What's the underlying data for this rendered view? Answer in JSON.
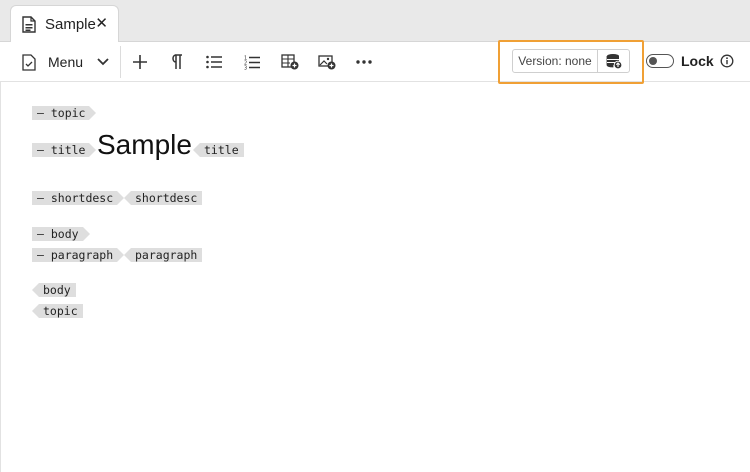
{
  "tab": {
    "title": "Sample",
    "close_glyph": "✕",
    "icon": "document-icon"
  },
  "toolbar": {
    "menu_label": "Menu",
    "icons": [
      "edit-doc-icon",
      "chevron-down-icon",
      "plus-icon",
      "pilcrow-icon",
      "bullet-list-icon",
      "numbered-list-icon",
      "insert-table-icon",
      "insert-image-icon",
      "more-icon"
    ],
    "version_label": "Version: none",
    "lock_label": "Lock",
    "lock_on": false,
    "highlight_color": "#f0a035"
  },
  "editor": {
    "tags": {
      "topic_open": "— topic",
      "title_open": "— title",
      "title_text": "Sample",
      "title_close": "title",
      "shortdesc_open": "— shortdesc",
      "shortdesc_close": "shortdesc",
      "body_open": "— body",
      "paragraph_open": "— paragraph",
      "paragraph_close": "paragraph",
      "body_close": "body",
      "topic_close": "topic"
    }
  }
}
